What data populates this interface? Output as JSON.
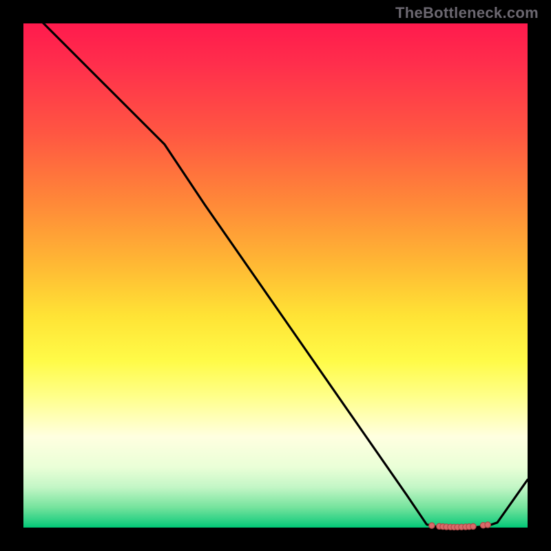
{
  "watermark": "TheBottleneck.com",
  "chart_data": {
    "type": "line",
    "title": "",
    "xlabel": "",
    "ylabel": "",
    "xlim": [
      0,
      100
    ],
    "ylim": [
      0,
      100
    ],
    "grid": false,
    "x": [
      0,
      8,
      16,
      24,
      28,
      36,
      44,
      52,
      60,
      68,
      76,
      80,
      82,
      84,
      86,
      88,
      90,
      92,
      94,
      100
    ],
    "y": [
      104,
      96,
      88,
      80,
      76,
      64,
      52.5,
      41,
      29.5,
      18,
      6.5,
      0.6,
      0.15,
      0.05,
      0.02,
      0.03,
      0.1,
      0.3,
      1.0,
      9.5
    ],
    "dots": {
      "x": [
        81.0,
        82.5,
        83.2,
        83.9,
        84.7,
        85.4,
        86.1,
        86.9,
        87.7,
        88.4,
        89.2,
        91.2,
        92.1
      ],
      "y": [
        0.4,
        0.25,
        0.2,
        0.15,
        0.12,
        0.1,
        0.1,
        0.12,
        0.15,
        0.18,
        0.23,
        0.45,
        0.55
      ]
    }
  }
}
